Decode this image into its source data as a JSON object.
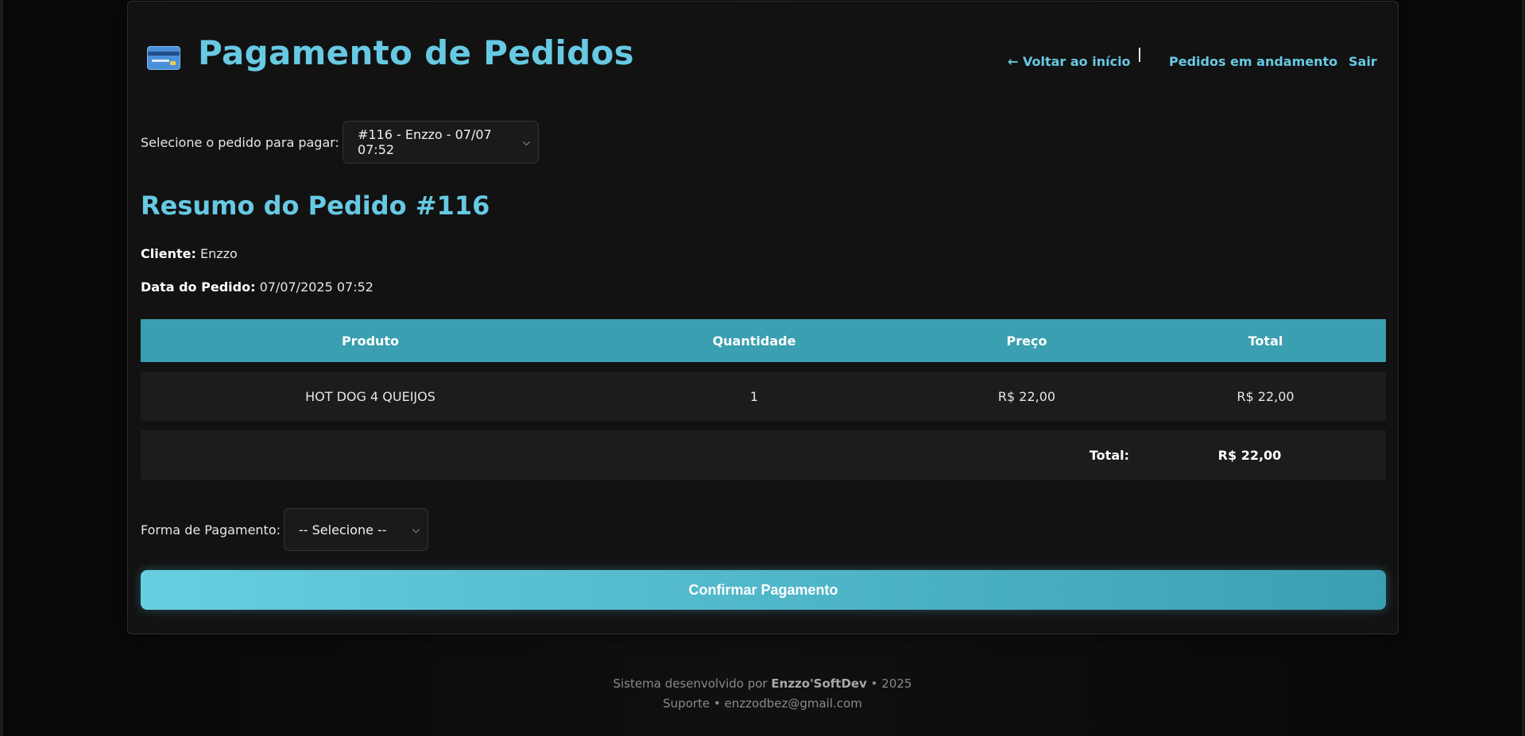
{
  "header": {
    "title": "Pagamento de Pedidos",
    "icon": "credit-card-icon",
    "nav": {
      "back": "← Voltar ao início",
      "orders": "Pedidos em andamento",
      "exit": "Sair"
    }
  },
  "order_select": {
    "label": "Selecione o pedido para pagar:",
    "selected": "#116 - Enzzo - 07/07 07:52"
  },
  "summary": {
    "title": "Resumo do Pedido #116",
    "client_label": "Cliente:",
    "client_value": "Enzzo",
    "date_label": "Data do Pedido:",
    "date_value": "07/07/2025 07:52"
  },
  "table": {
    "headers": [
      "Produto",
      "Quantidade",
      "Preço",
      "Total"
    ],
    "rows": [
      [
        "HOT DOG 4 QUEIJOS",
        "1",
        "R$ 22,00",
        "R$ 22,00"
      ]
    ],
    "total_label": "Total:",
    "total_value": "R$ 22,00"
  },
  "payment": {
    "label": "Forma de Pagamento:",
    "selected": "-- Selecione --"
  },
  "confirm_label": "Confirmar Pagamento",
  "footer": {
    "prefix": "Sistema desenvolvido por",
    "brand": "Enzzo'SoftDev",
    "year": "• 2025",
    "support": "Suporte • enzzodbez@gmail.com"
  },
  "colors": {
    "accent": "#67c9e3",
    "table_header": "#3a9fb0",
    "background": "#121212"
  }
}
